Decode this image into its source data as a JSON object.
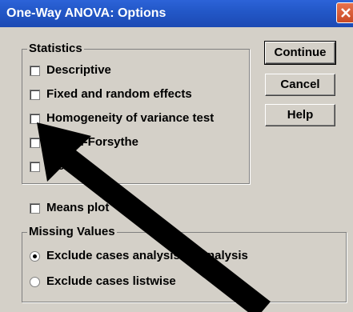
{
  "window": {
    "title": "One-Way ANOVA: Options"
  },
  "statistics": {
    "legend": "Statistics",
    "options": [
      {
        "label": "Descriptive",
        "checked": false
      },
      {
        "label": "Fixed and random effects",
        "checked": false
      },
      {
        "label": "Homogeneity of variance test",
        "checked": false
      },
      {
        "label": "Brown-Forsythe",
        "checked": false
      },
      {
        "label": "Welch",
        "checked": false
      }
    ]
  },
  "means_plot": {
    "label": "Means plot",
    "checked": false
  },
  "missing_values": {
    "legend": "Missing Values",
    "options": [
      {
        "label": "Exclude cases analysis by analysis",
        "selected": true
      },
      {
        "label": "Exclude cases listwise",
        "selected": false
      }
    ]
  },
  "buttons": {
    "continue": "Continue",
    "cancel": "Cancel",
    "help": "Help"
  },
  "annotation": {
    "arrow_color": "#000000",
    "arrow_target": "Homogeneity of variance test"
  }
}
